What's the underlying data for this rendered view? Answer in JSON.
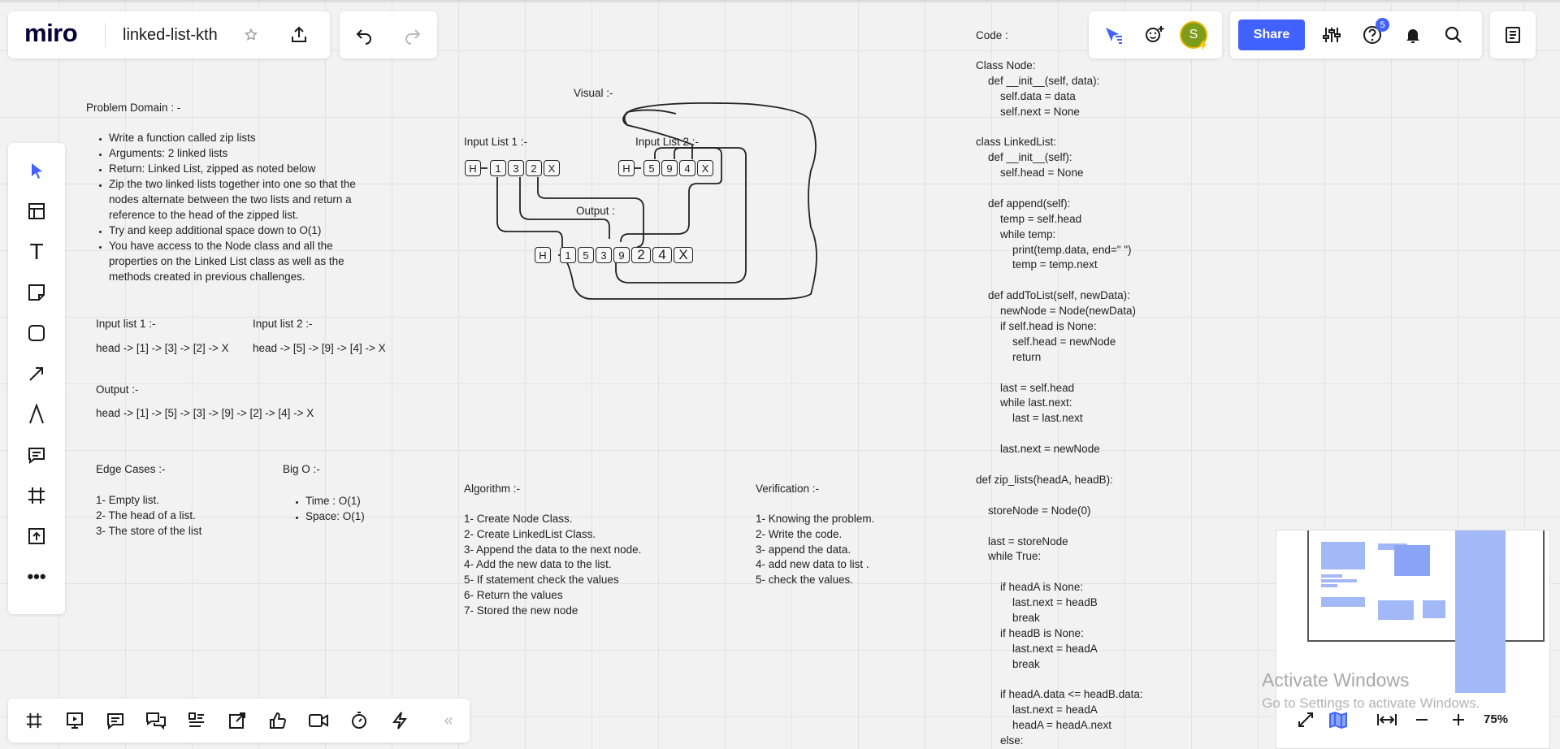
{
  "app": {
    "logo": "miro",
    "board_title": "linked-list-kth",
    "zoom": "75%"
  },
  "topbar": {
    "share_label": "Share",
    "notification_badge": "5",
    "avatar_letter": "S"
  },
  "problem": {
    "heading": "Problem Domain : -",
    "bullets": [
      "Write a function called zip lists",
      "Arguments: 2 linked lists",
      "Return: Linked List, zipped as noted below",
      "Zip the two linked lists together into one so that the nodes  alternate between the two lists and return a reference to the head of  the zipped list.",
      "Try and keep additional space down to O(1)",
      "You have access to the Node class and all the properties on the  Linked List class as well as the methods created in previous challenges."
    ]
  },
  "inputs": {
    "list1_label": "Input list 1 :-",
    "list1_value": "head -> [1] -> [3] -> [2] -> X",
    "list2_label": "Input list 2 :-",
    "list2_value": "head -> [5] -> [9] -> [4] -> X",
    "output_label": "Output :-",
    "output_value": "head -> [1] -> [5] -> [3] -> [9] -> [2] -> [4] -> X"
  },
  "edge_cases": {
    "heading": "Edge Cases :-",
    "items": [
      "1- Empty list.",
      "2- The head of a list.",
      "3- The store of the list"
    ]
  },
  "big_o": {
    "heading": "Big O :-",
    "items": [
      "Time : O(1)",
      "Space: O(1)"
    ]
  },
  "visual": {
    "heading": "Visual :-",
    "list1_label": "Input List 1 :-",
    "list2_label": "Input List 2 :-",
    "output_label": "Output :",
    "list1_nodes": [
      "H",
      "1",
      "3",
      "2",
      "X"
    ],
    "list2_nodes": [
      "H",
      "5",
      "9",
      "4",
      "X"
    ],
    "output_nodes": [
      "H",
      "1",
      "5",
      "3",
      "9",
      "2",
      "4",
      "X"
    ]
  },
  "algorithm": {
    "heading": "Algorithm :-",
    "items": [
      "1- Create Node Class.",
      "2- Create LinkedList Class.",
      "3- Append the data to the next node.",
      "4- Add the new data to the list.",
      "5- If statement check the values",
      "6- Return the values",
      "7- Stored the new node"
    ]
  },
  "verification": {
    "heading": "Verification :-",
    "items": [
      "1- Knowing the problem.",
      "2- Write the code.",
      "3- append the data.",
      "4- add new data to list .",
      "5- check the values."
    ]
  },
  "code": {
    "heading": "Code :",
    "lines": [
      "",
      "Class Node:",
      "    def __init__(self, data):",
      "        self.data = data",
      "        self.next = None",
      "",
      "class LinkedList:",
      "    def __init__(self):",
      "        self.head = None",
      "",
      "    def append(self):",
      "        temp = self.head",
      "        while temp:",
      "            print(temp.data, end=\" \")",
      "            temp = temp.next",
      "",
      "    def addToList(self, newData):",
      "        newNode = Node(newData)",
      "        if self.head is None:",
      "            self.head = newNode",
      "            return",
      "",
      "        last = self.head",
      "        while last.next:",
      "            last = last.next",
      "",
      "        last.next = newNode",
      "",
      "def zip_lists(headA, headB):",
      "",
      "    storeNode = Node(0)",
      "",
      "    last = storeNode",
      "    while True:",
      "",
      "        if headA is None:",
      "            last.next = headB",
      "            break",
      "        if headB is None:",
      "            last.next = headA",
      "            break",
      "",
      "        if headA.data <= headB.data:",
      "            last.next = headA",
      "            headA = headA.next",
      "        else:"
    ]
  },
  "watermark": {
    "title": "Activate Windows",
    "subtitle": "Go to Settings to activate Windows."
  }
}
